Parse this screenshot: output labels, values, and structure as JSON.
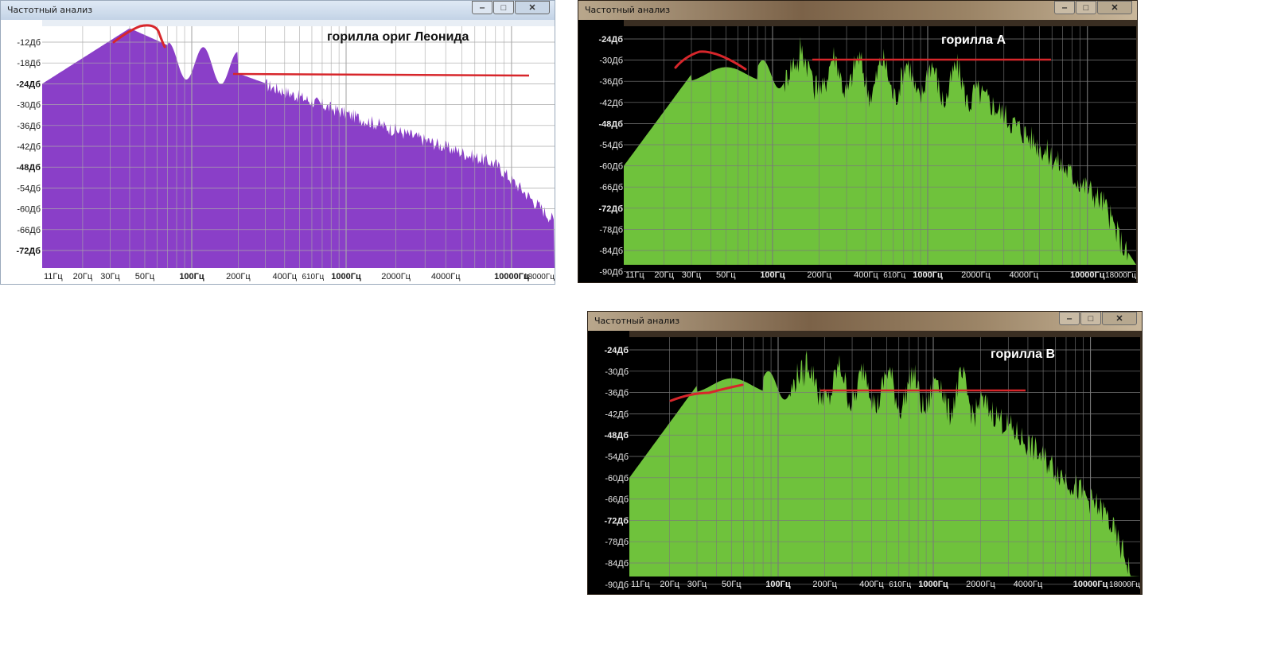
{
  "windows": [
    {
      "title": "Частотный анализ",
      "theme": "light",
      "label": "горилла ориг Леонида",
      "ylabels": [
        "-12Дб",
        "-18Дб",
        "-24Дб",
        "-30Дб",
        "-36Дб",
        "-42Дб",
        "-48Дб",
        "-54Дб",
        "-60Дб",
        "-66Дб",
        "-72Дб"
      ],
      "bold_ylabels": [
        "-24Дб",
        "-48Дб",
        "-72Дб"
      ],
      "xlabels": [
        "11Гц",
        "20Гц",
        "30Гц",
        "50Гц",
        "100Гц",
        "200Гц",
        "400Гц",
        "610Гц",
        "1000Гц",
        "2000Гц",
        "4000Гц",
        "10000Гц",
        "18000Гц"
      ],
      "bold_xlabels": [
        "100Гц",
        "1000Гц",
        "10000Гц"
      ],
      "colors": {
        "fill": "#8a3fc8",
        "bg": "#ffffff",
        "grid": "#a9a9a9",
        "text": "#1a1a1a",
        "mark": "#d7262b"
      }
    },
    {
      "title": "Частотный анализ",
      "theme": "dark",
      "label": "горилла А",
      "ylabels": [
        "-24Дб",
        "-30Дб",
        "-36Дб",
        "-42Дб",
        "-48Дб",
        "-54Дб",
        "-60Дб",
        "-66Дб",
        "-72Дб",
        "-78Дб",
        "-84Дб",
        "-90Дб"
      ],
      "bold_ylabels": [
        "-24Дб",
        "-48Дб",
        "-72Дб"
      ],
      "xlabels": [
        "11Гц",
        "20Гц",
        "30Гц",
        "50Гц",
        "100Гц",
        "200Гц",
        "400Гц",
        "610Гц",
        "1000Гц",
        "2000Гц",
        "4000Гц",
        "10000Гц",
        "18000Гц"
      ],
      "bold_xlabels": [
        "100Гц",
        "1000Гц",
        "10000Гц"
      ],
      "colors": {
        "fill": "#6fc23c",
        "bg": "#000000",
        "grid": "#7a7a7a",
        "text": "#e9e9e9",
        "mark": "#d7262b"
      }
    },
    {
      "title": "Частотный анализ",
      "theme": "dark",
      "label": "горилла В",
      "ylabels": [
        "-24Дб",
        "-30Дб",
        "-36Дб",
        "-42Дб",
        "-48Дб",
        "-54Дб",
        "-60Дб",
        "-66Дб",
        "-72Дб",
        "-78Дб",
        "-84Дб",
        "-90Дб"
      ],
      "bold_ylabels": [
        "-24Дб",
        "-48Дб",
        "-72Дб"
      ],
      "xlabels": [
        "11Гц",
        "20Гц",
        "30Гц",
        "50Гц",
        "100Гц",
        "200Гц",
        "400Гц",
        "610Гц",
        "1000Гц",
        "2000Гц",
        "4000Гц",
        "10000Гц",
        "18000Гц"
      ],
      "bold_xlabels": [
        "100Гц",
        "1000Гц",
        "10000Гц"
      ],
      "colors": {
        "fill": "#6fc23c",
        "bg": "#000000",
        "grid": "#7a7a7a",
        "text": "#e9e9e9",
        "mark": "#d7262b"
      }
    }
  ],
  "window_controls": {
    "minimize": "‒",
    "maximize": "□",
    "close": "✕"
  }
}
